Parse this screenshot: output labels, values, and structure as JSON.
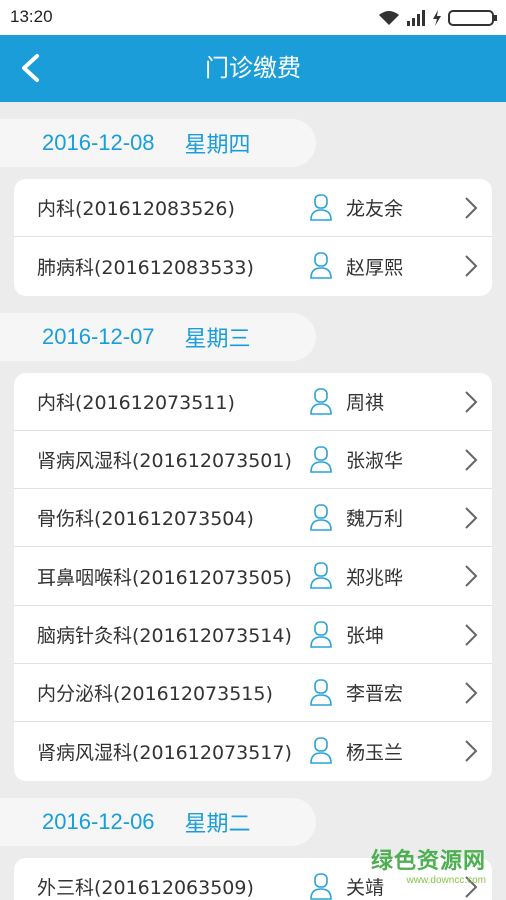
{
  "status_bar": {
    "time": "13:20"
  },
  "header": {
    "title": "门诊缴费",
    "back_icon": "chevron-left-icon"
  },
  "colors": {
    "accent": "#1a9dd9",
    "background": "#ececec",
    "card": "#ffffff"
  },
  "groups": [
    {
      "date": "2016-12-08",
      "weekday": "星期四",
      "items": [
        {
          "dept": "内科(201612083526)",
          "doctor": "龙友余"
        },
        {
          "dept": "肺病科(201612083533)",
          "doctor": "赵厚熙"
        }
      ]
    },
    {
      "date": "2016-12-07",
      "weekday": "星期三",
      "items": [
        {
          "dept": "内科(201612073511)",
          "doctor": "周祺"
        },
        {
          "dept": "肾病风湿科(201612073501)",
          "doctor": "张淑华"
        },
        {
          "dept": "骨伤科(201612073504)",
          "doctor": "魏万利"
        },
        {
          "dept": "耳鼻咽喉科(201612073505)",
          "doctor": "郑兆晔"
        },
        {
          "dept": "脑病针灸科(201612073514)",
          "doctor": "张坤"
        },
        {
          "dept": "内分泌科(201612073515)",
          "doctor": "李晋宏"
        },
        {
          "dept": "肾病风湿科(201612073517)",
          "doctor": "杨玉兰"
        }
      ]
    },
    {
      "date": "2016-12-06",
      "weekday": "星期二",
      "items": [
        {
          "dept": "外三科(201612063509)",
          "doctor": "关靖"
        }
      ]
    }
  ],
  "watermark": {
    "main": "绿色资源网",
    "sub": "www.downcc.com"
  }
}
